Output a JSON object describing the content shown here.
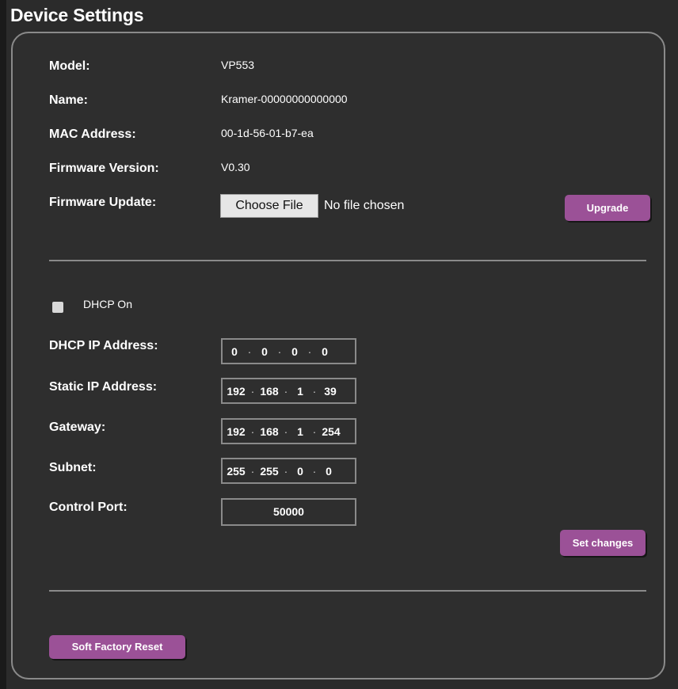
{
  "page": {
    "title": "Device Settings"
  },
  "device_info": {
    "model_label": "Model:",
    "model_value": "VP553",
    "name_label": "Name:",
    "name_value": "Kramer-00000000000000",
    "mac_label": "MAC Address:",
    "mac_value": "00-1d-56-01-b7-ea",
    "firmware_version_label": "Firmware Version:",
    "firmware_version_value": "V0.30",
    "firmware_update_label": "Firmware Update:",
    "choose_file_label": "Choose File",
    "file_status": "No file chosen",
    "upgrade_label": "Upgrade"
  },
  "network": {
    "dhcp_on_label": "DHCP On",
    "dhcp_checked": false,
    "dhcp_ip_label": "DHCP IP Address:",
    "dhcp_ip": [
      "0",
      "0",
      "0",
      "0"
    ],
    "static_ip_label": "Static IP Address:",
    "static_ip": [
      "192",
      "168",
      "1",
      "39"
    ],
    "gateway_label": "Gateway:",
    "gateway": [
      "192",
      "168",
      "1",
      "254"
    ],
    "subnet_label": "Subnet:",
    "subnet": [
      "255",
      "255",
      "0",
      "0"
    ],
    "control_port_label": "Control Port:",
    "control_port": "50000",
    "set_changes_label": "Set changes"
  },
  "reset": {
    "soft_factory_reset_label": "Soft Factory Reset"
  },
  "colors": {
    "background": "#2b2b2b",
    "accent": "#9b5197",
    "border": "#8a8a8a"
  }
}
